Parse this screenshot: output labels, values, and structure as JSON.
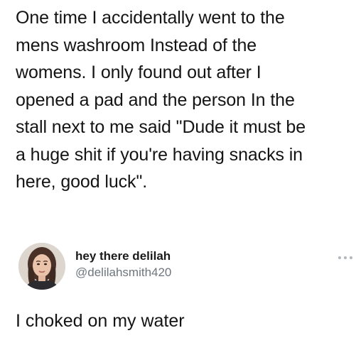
{
  "post": {
    "lines": [
      "One time I accidentally went to the",
      "mens washroom Instead of the",
      "womens. I only found out after I",
      "opened a pad and the person In the",
      "stall next to me said \"Dude it must be",
      "a huge shit if you're having snacks in",
      "here, good luck\"."
    ]
  },
  "reply": {
    "display_name": "hey there delilah",
    "handle": "@delilahsmith420",
    "text": "I choked on my water",
    "more_icon": "more-horizontal-icon"
  },
  "colors": {
    "text": "#141414",
    "handle": "#6e767d",
    "background": "#ffffff"
  }
}
